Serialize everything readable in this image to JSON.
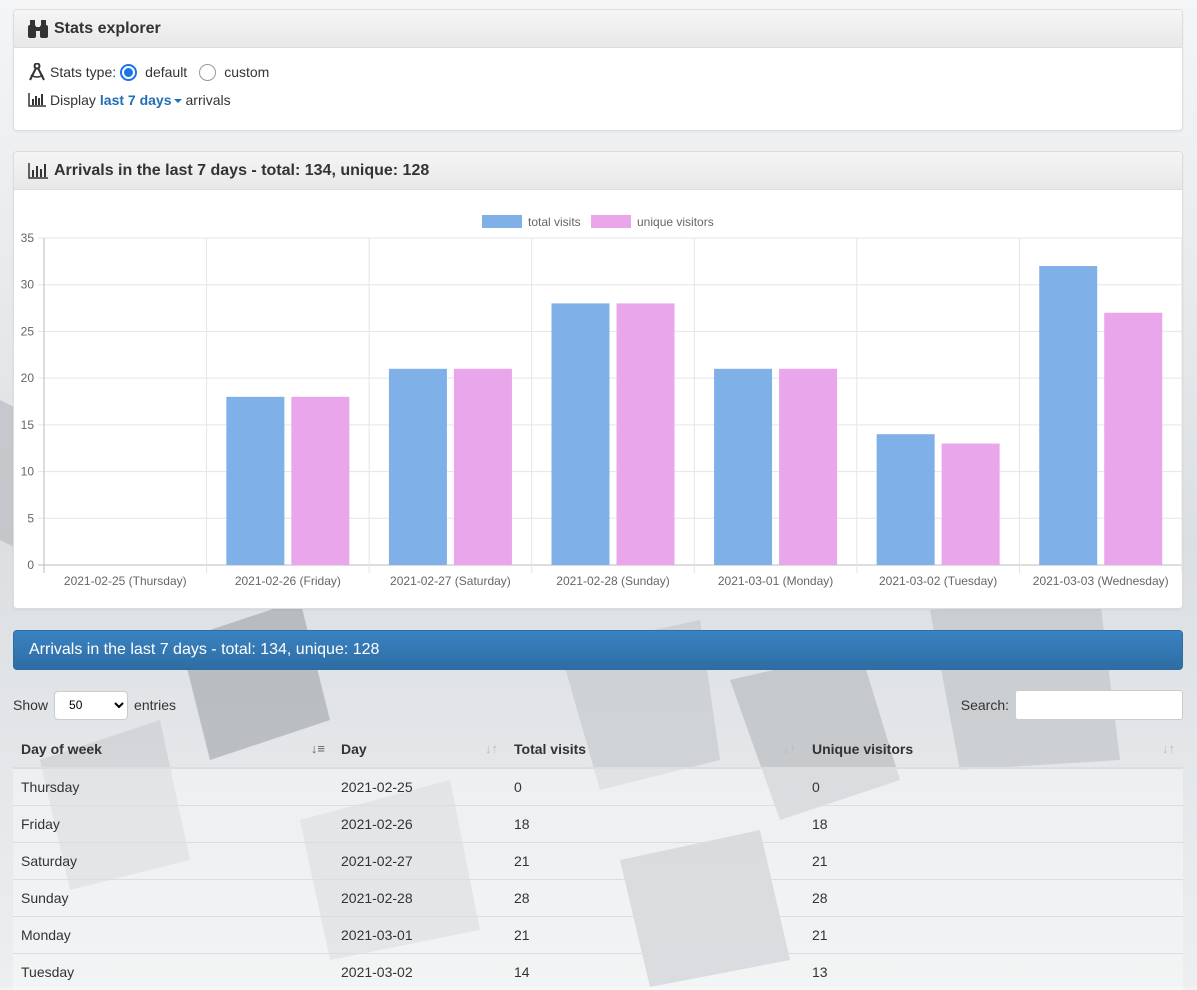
{
  "explorer": {
    "title": "Stats explorer",
    "stats_type_label": "Stats type:",
    "options": [
      "default",
      "custom"
    ],
    "selected_option": "default",
    "display_prefix": "Display",
    "range_label": "last 7 days",
    "display_suffix": "arrivals"
  },
  "chart_panel": {
    "title": "Arrivals in the last 7 days - total: 134, unique: 128"
  },
  "chart_data": {
    "type": "bar",
    "categories": [
      "2021-02-25 (Thursday)",
      "2021-02-26 (Friday)",
      "2021-02-27 (Saturday)",
      "2021-02-28 (Sunday)",
      "2021-03-01 (Monday)",
      "2021-03-02 (Tuesday)",
      "2021-03-03 (Wednesday)"
    ],
    "series": [
      {
        "name": "total visits",
        "values": [
          0,
          18,
          21,
          28,
          21,
          14,
          32
        ],
        "color": "#80b0e8"
      },
      {
        "name": "unique visitors",
        "values": [
          0,
          18,
          21,
          28,
          21,
          13,
          27
        ],
        "color": "#eaa6eb"
      }
    ],
    "ylim": [
      0,
      35
    ],
    "yticks": [
      0,
      5,
      10,
      15,
      20,
      25,
      30,
      35
    ],
    "legend": "top-center",
    "grid": true
  },
  "table_section": {
    "title": "Arrivals in the last 7 days - total: 134, unique: 128",
    "show_label": "Show",
    "entries_label": "entries",
    "page_size": "50",
    "search_label": "Search:",
    "columns": [
      "Day of week",
      "Day",
      "Total visits",
      "Unique visitors"
    ],
    "rows": [
      [
        "Thursday",
        "2021-02-25",
        "0",
        "0"
      ],
      [
        "Friday",
        "2021-02-26",
        "18",
        "18"
      ],
      [
        "Saturday",
        "2021-02-27",
        "21",
        "21"
      ],
      [
        "Sunday",
        "2021-02-28",
        "28",
        "28"
      ],
      [
        "Monday",
        "2021-03-01",
        "21",
        "21"
      ],
      [
        "Tuesday",
        "2021-03-02",
        "14",
        "13"
      ]
    ]
  }
}
